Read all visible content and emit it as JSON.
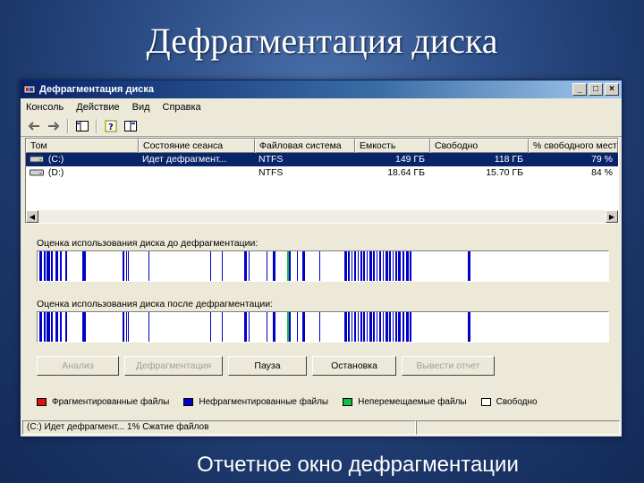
{
  "slide": {
    "title": "Дефрагментация диска",
    "caption": "Отчетное окно  дефрагментации"
  },
  "window": {
    "title": "Дефрагментация диска",
    "controls": [
      "_",
      "□",
      "×"
    ]
  },
  "menu": [
    "Консоль",
    "Действие",
    "Вид",
    "Справка"
  ],
  "toolbar": {
    "icons": [
      "back-arrow-icon",
      "forward-arrow-icon",
      "console-tree-icon",
      "help-icon",
      "properties-icon"
    ]
  },
  "volumes": {
    "columns": [
      "Том",
      "Состояние сеанса",
      "Файловая система",
      "Емкость",
      "Свободно",
      "% свободного мест"
    ],
    "rows": [
      {
        "volume": "(C:)",
        "state": "Идет дефрагмент...",
        "fs": "NTFS",
        "capacity": "149 ГБ",
        "free": "118 ГБ",
        "pct": "79 %"
      },
      {
        "volume": "(D:)",
        "state": "",
        "fs": "NTFS",
        "capacity": "18.64 ГБ",
        "free": "15.70 ГБ",
        "pct": "84 %"
      }
    ]
  },
  "analysis": {
    "before_label": "Оценка использования диска до дефрагментации:",
    "after_label": "Оценка использования диска после дефрагментации:"
  },
  "buttons": {
    "analyze": "Анализ",
    "defrag": "Дефрагментация",
    "pause": "Пауза",
    "stop": "Остановка",
    "report": "Вывести отчет"
  },
  "legend": [
    {
      "label": "Фрагментированные файлы",
      "color": "#e01010"
    },
    {
      "label": "Нефрагментированные файлы",
      "color": "#0000c8"
    },
    {
      "label": "Неперемещаемые файлы",
      "color": "#10c040"
    },
    {
      "label": "Свободно",
      "color": "#ffffff"
    }
  ],
  "status": {
    "text": "(C:) Идет дефрагмент... 1%  Сжатие файлов"
  },
  "colors": {
    "blue": "#0000c8",
    "green": "#10c040",
    "free": "#ffffff"
  }
}
